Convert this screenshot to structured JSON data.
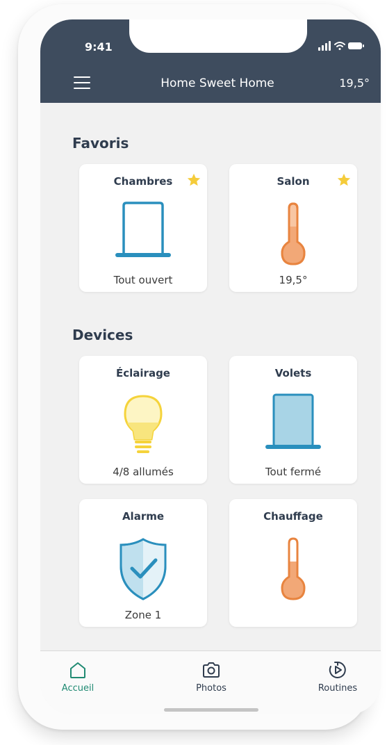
{
  "status_bar": {
    "time": "9:41"
  },
  "header": {
    "title": "Home Sweet Home",
    "temperature": "19,5°"
  },
  "favorites": {
    "title": "Favoris",
    "cards": [
      {
        "title": "Chambres",
        "status": "Tout ouvert",
        "icon": "window-open-icon",
        "favorite": true
      },
      {
        "title": "Salon",
        "status": "19,5°",
        "icon": "thermometer-icon",
        "favorite": true
      }
    ]
  },
  "devices": {
    "title": "Devices",
    "cards": [
      {
        "title": "Éclairage",
        "status": "4/8 allumés",
        "icon": "lightbulb-icon"
      },
      {
        "title": "Volets",
        "status": "Tout fermé",
        "icon": "shutter-closed-icon"
      },
      {
        "title": "Alarme",
        "status": "Zone 1",
        "icon": "shield-check-icon"
      },
      {
        "title": "Chauffage",
        "status": "",
        "icon": "thermometer-icon"
      }
    ]
  },
  "bottom_nav": {
    "items": [
      {
        "label": "Accueil",
        "icon": "home-icon",
        "active": true
      },
      {
        "label": "Photos",
        "icon": "camera-icon",
        "active": false
      },
      {
        "label": "Routines",
        "icon": "play-refresh-icon",
        "active": false
      }
    ]
  },
  "colors": {
    "header_bg": "#3e4c5e",
    "accent_blue": "#2a8fbd",
    "accent_orange": "#e8843f",
    "accent_yellow": "#f5d33b",
    "star": "#f5cc3a",
    "active_nav": "#1f8a72"
  }
}
